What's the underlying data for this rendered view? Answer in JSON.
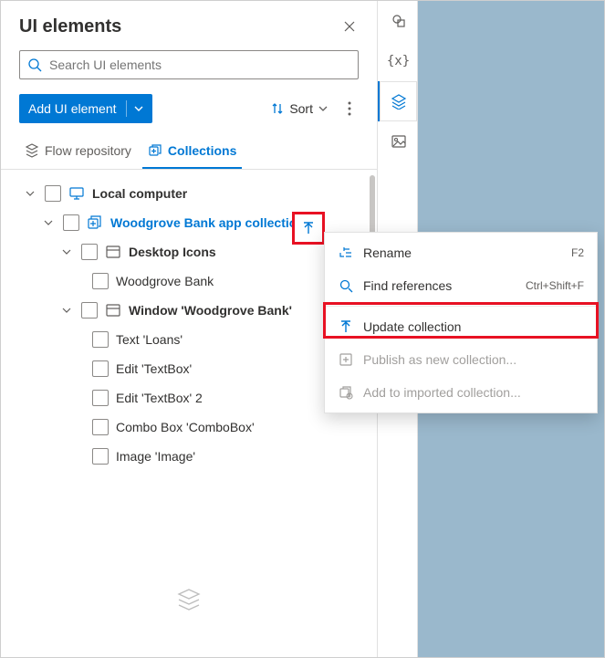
{
  "panel": {
    "title": "UI elements",
    "search_placeholder": "Search UI elements",
    "add_button": "Add UI element",
    "sort": "Sort",
    "tabs": {
      "flow": "Flow repository",
      "collections": "Collections"
    }
  },
  "tree": {
    "root": "Local computer",
    "collection": "Woodgrove Bank app collection",
    "group1": "Desktop Icons",
    "item1": "Woodgrove Bank",
    "group2": "Window 'Woodgrove Bank'",
    "g2_items": [
      "Text 'Loans'",
      "Edit 'TextBox'",
      "Edit 'TextBox' 2",
      "Combo Box 'ComboBox'",
      "Image 'Image'"
    ]
  },
  "menu": {
    "rename": {
      "label": "Rename",
      "accel": "F2"
    },
    "find": {
      "label": "Find references",
      "accel": "Ctrl+Shift+F"
    },
    "update": {
      "label": "Update collection"
    },
    "publish": {
      "label": "Publish as new collection..."
    },
    "add_imported": {
      "label": "Add to imported collection..."
    }
  }
}
